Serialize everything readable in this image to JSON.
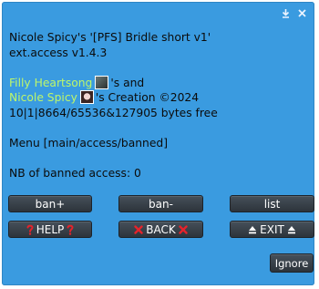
{
  "window": {
    "controls": [
      "minimize-icon",
      "close-icon"
    ]
  },
  "dialog": {
    "title_line": "Nicole Spicy's '[PFS] Bridle short v1'",
    "version_line": "ext.access v1.4.3",
    "credit": {
      "name1": "Filly Heartsong",
      "between": "'s and",
      "name2": "Nicole Spicy",
      "after": "'s Creation ©2024"
    },
    "memory_line": "10|1|8664/65536&127905 bytes free",
    "menu_line": "Menu [main/access/banned]",
    "banned_line": "NB of banned access: 0"
  },
  "buttons": {
    "ban_plus": "ban+",
    "ban_minus": "ban-",
    "list": "list",
    "help": "HELP",
    "back": "BACK",
    "exit": "EXIT",
    "ignore": "Ignore"
  },
  "colors": {
    "dialog_bg": "#3a9be0",
    "link": "#bdf66a",
    "button_bg": "#3a434c"
  }
}
